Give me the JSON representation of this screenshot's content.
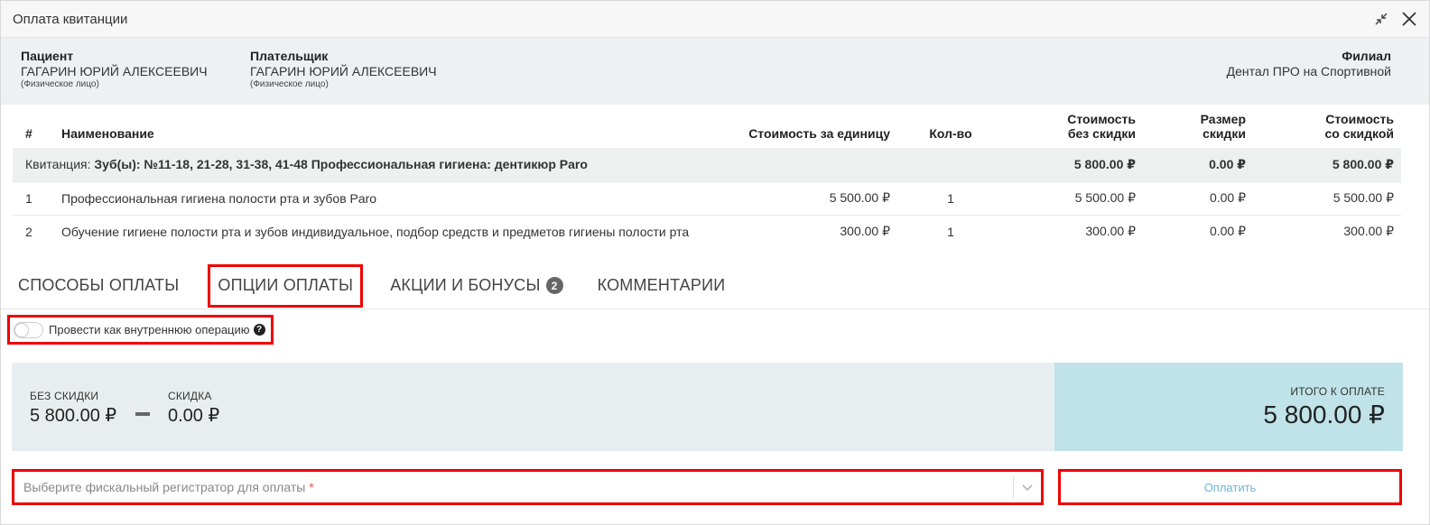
{
  "window": {
    "title": "Оплата квитанции",
    "minimize_icon": "collapse-arrows-icon",
    "close_icon": "close-icon"
  },
  "info": {
    "patient_label": "Пациент",
    "patient_name": "ГАГАРИН ЮРИЙ АЛЕКСЕЕВИЧ",
    "patient_type": "(Физическое лицо)",
    "payer_label": "Плательщик",
    "payer_name": "ГАГАРИН ЮРИЙ АЛЕКСЕЕВИЧ",
    "payer_type": "(Физическое лицо)",
    "branch_label": "Филиал",
    "branch_name": "Дентал ПРО на Спортивной"
  },
  "table": {
    "headers": {
      "num": "#",
      "name": "Наименование",
      "unit_price": "Стоимость за единицу",
      "qty": "Кол-во",
      "no_discount_1": "Стоимость",
      "no_discount_2": "без скидки",
      "discount_1": "Размер",
      "discount_2": "скидки",
      "total_1": "Стоимость",
      "total_2": "со скидкой"
    },
    "receipt": {
      "prefix": "Квитанция:",
      "title": "Зуб(ы): №11-18, 21-28, 31-38, 41-48 Профессиональная гигиена: дентикюр Paro",
      "no_discount": "5 800.00 ₽",
      "discount": "0.00 ₽",
      "total": "5 800.00 ₽"
    },
    "rows": [
      {
        "num": "1",
        "name": "Профессиональная гигиена полости рта и зубов Paro",
        "unit_price": "5 500.00 ₽",
        "qty": "1",
        "no_discount": "5 500.00 ₽",
        "discount": "0.00 ₽",
        "total": "5 500.00 ₽"
      },
      {
        "num": "2",
        "name": "Обучение гигиене полости рта и зубов индивидуальное, подбор средств и предметов гигиены полости рта",
        "unit_price": "300.00 ₽",
        "qty": "1",
        "no_discount": "300.00 ₽",
        "discount": "0.00 ₽",
        "total": "300.00 ₽"
      }
    ]
  },
  "tabs": [
    {
      "label": "СПОСОБЫ ОПЛАТЫ"
    },
    {
      "label": "ОПЦИИ ОПЛАТЫ",
      "active": true
    },
    {
      "label": "АКЦИИ И БОНУСЫ",
      "badge": "2"
    },
    {
      "label": "КОММЕНТАРИИ"
    }
  ],
  "internal_op": {
    "label": "Провести как внутреннюю операцию",
    "checked": false,
    "help_icon": "question-circle-icon"
  },
  "summary": {
    "no_discount_label": "БЕЗ СКИДКИ",
    "no_discount_value": "5 800.00 ₽",
    "discount_label": "СКИДКА",
    "discount_value": "0.00 ₽",
    "total_label": "ИТОГО К ОПЛАТЕ",
    "total_value": "5 800.00 ₽"
  },
  "fiscal": {
    "placeholder": "Выберите фискальный регистратор для оплаты",
    "required_mark": "*"
  },
  "pay_button": "Оплатить",
  "colors": {
    "highlight": "#ee0000",
    "total_bg": "#bfe3e8",
    "pay_text": "#6fb6d8"
  }
}
